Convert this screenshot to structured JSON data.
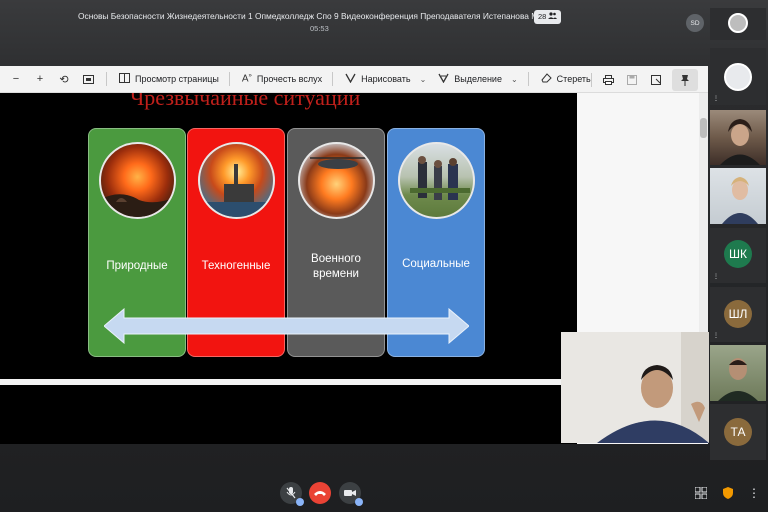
{
  "meeting": {
    "title": "Основы Безопасности Жизнедеятельности 1 Опмедколледж Спо 9 Видеоконференция Преподавателя Истепанова Ми",
    "participants_count": "28",
    "elapsed": "05:53",
    "host_initials": "SD"
  },
  "toolbar": {
    "page_view": "Просмотр страницы",
    "read_aloud": "Прочесть вслух",
    "draw": "Нарисовать",
    "highlight": "Выделение",
    "erase": "Стереть"
  },
  "slide": {
    "title": "Чрезвычайные ситуации",
    "cards": [
      {
        "label": "Природные",
        "color": "#4b9a3f"
      },
      {
        "label": "Техногенные",
        "color": "#f21410"
      },
      {
        "label": "Военного времени",
        "color": "#5a5a5a"
      },
      {
        "label": "Социальные",
        "color": "#4b88d3"
      }
    ]
  },
  "participants": [
    {
      "initials": "ШК",
      "color": "#1e7a4e"
    },
    {
      "initials": "ШЛ",
      "color": "#8a6a3c"
    },
    {
      "initials": "ТА",
      "color": "#8a6a3c"
    }
  ]
}
